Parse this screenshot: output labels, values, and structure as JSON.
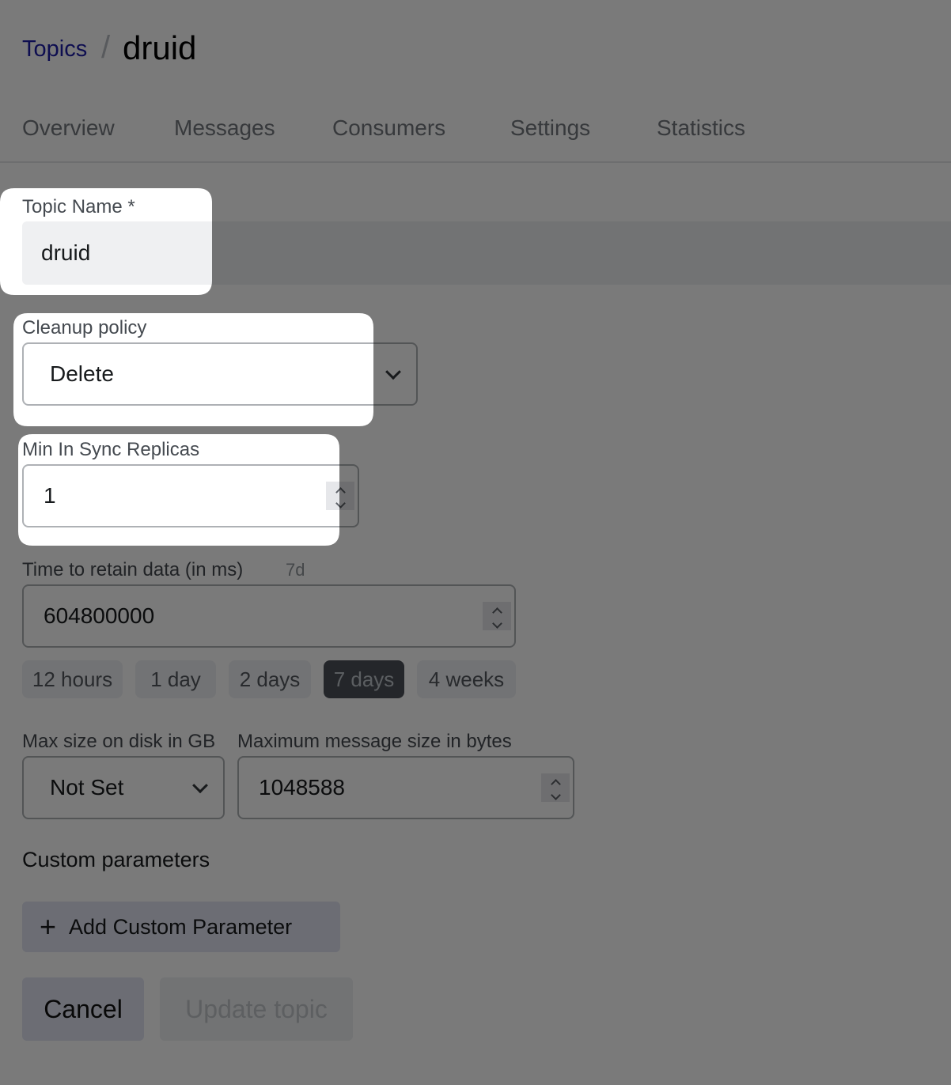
{
  "breadcrumb": {
    "parent": "Topics",
    "separator": "/",
    "current": "druid"
  },
  "tabs": [
    "Overview",
    "Messages",
    "Consumers",
    "Settings",
    "Statistics"
  ],
  "topic_name": {
    "label": "Topic Name *",
    "value": "druid"
  },
  "cleanup_policy": {
    "label": "Cleanup policy",
    "value": "Delete"
  },
  "min_in_sync": {
    "label": "Min In Sync Replicas",
    "value": "1"
  },
  "retention": {
    "label": "Time to retain data (in ms)",
    "hint": "7d",
    "value": "604800000",
    "presets": [
      "12 hours",
      "1 day",
      "2 days",
      "7 days",
      "4 weeks"
    ],
    "active_preset": "7 days"
  },
  "max_size": {
    "label": "Max size on disk in GB",
    "value": "Not Set"
  },
  "max_message": {
    "label": "Maximum message size in bytes",
    "value": "1048588"
  },
  "custom": {
    "title": "Custom parameters",
    "add_label": "Add Custom Parameter",
    "add_icon": "+"
  },
  "actions": {
    "cancel": "Cancel",
    "update": "Update topic"
  },
  "colors": {
    "link": "#1e1ea8",
    "active_chip": "#4c5158",
    "overlay": "rgba(0,0,0,0.52)"
  }
}
